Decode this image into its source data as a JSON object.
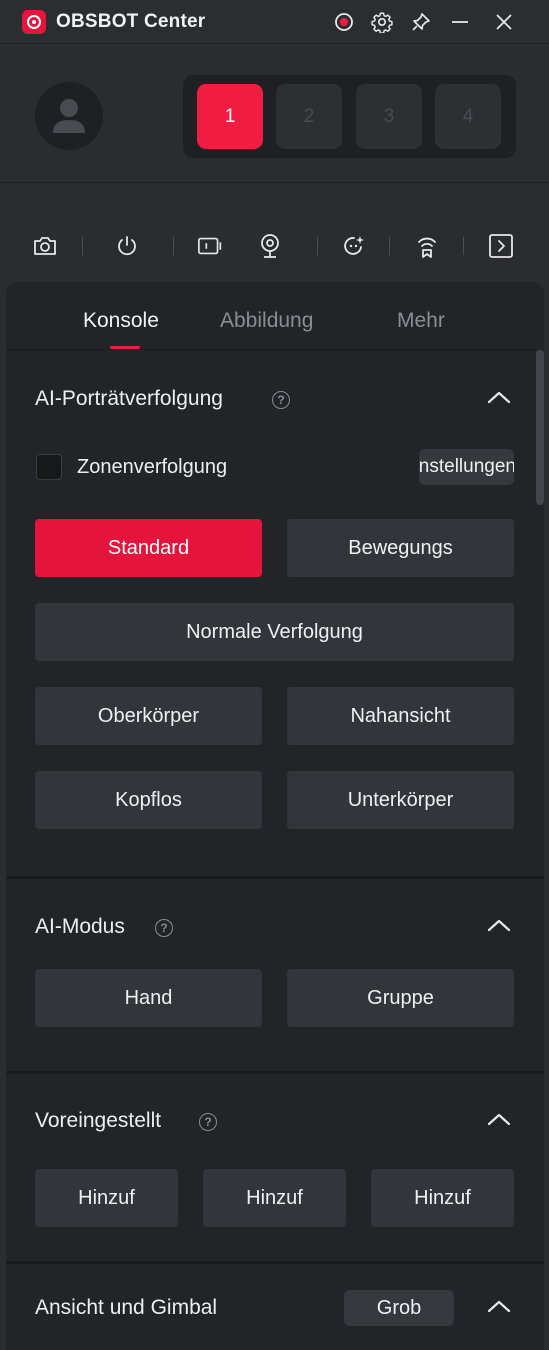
{
  "app": {
    "title": "OBSBOT Center"
  },
  "titlebar_icons": [
    "record-icon",
    "gear-icon",
    "pin-icon",
    "minimize-icon",
    "close-icon"
  ],
  "profile": {
    "avatar": "user-avatar"
  },
  "device_slots": [
    {
      "label": "1",
      "active": true
    },
    {
      "label": "2",
      "active": false
    },
    {
      "label": "3",
      "active": false
    },
    {
      "label": "4",
      "active": false
    }
  ],
  "toolbar_icons": [
    "camera-icon",
    "power-icon",
    "video-icon",
    "webcam-icon",
    "refresh-sparkle-icon",
    "signal-icon",
    "expand-panel-icon"
  ],
  "tabs": [
    {
      "label": "Konsole",
      "active": true
    },
    {
      "label": "Abbildung",
      "active": false
    },
    {
      "label": "Mehr",
      "active": false
    }
  ],
  "portrait_tracking": {
    "title": "AI-Porträtverfolgung",
    "zone_tracking_label": "Zonenverfolgung",
    "zone_tracking_checked": false,
    "settings_label": "Einstellungen",
    "mode_standard": "Standard",
    "mode_motion": "Bewegungs",
    "normal_tracking": "Normale Verfolgung",
    "upper_body": "Oberkörper",
    "close_up": "Nahansicht",
    "headless": "Kopflos",
    "lower_body": "Unterkörper"
  },
  "ai_mode": {
    "title": "AI-Modus",
    "hand": "Hand",
    "group": "Gruppe"
  },
  "presets": {
    "title": "Voreingestellt",
    "add_1": "Hinzuf",
    "add_2": "Hinzuf",
    "add_3": "Hinzuf"
  },
  "view_gimbal": {
    "title": "Ansicht und Gimbal",
    "mode_label": "Grob"
  },
  "colors": {
    "accent": "#f01c42",
    "panel": "#232427",
    "button": "#33353a"
  }
}
